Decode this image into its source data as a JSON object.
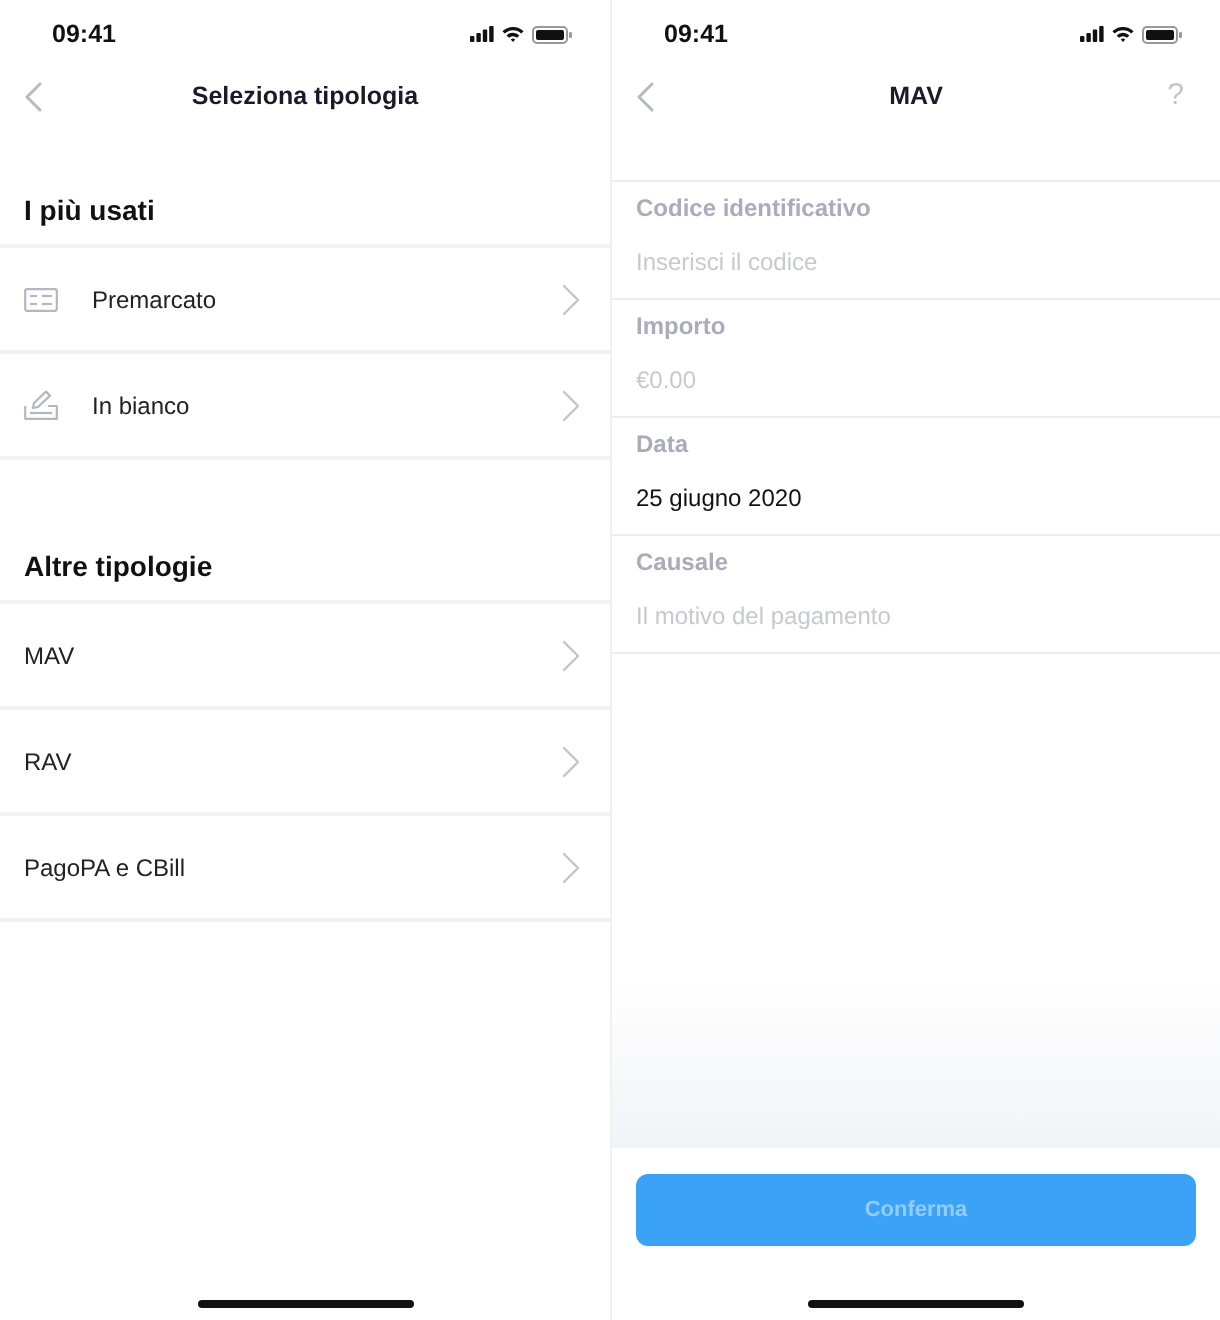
{
  "left_screen": {
    "status_bar": {
      "time": "09:41"
    },
    "nav": {
      "title": "Seleziona tipologia"
    },
    "sections": [
      {
        "title": "I più usati",
        "items": [
          {
            "label": "Premarcato",
            "kind": "card"
          },
          {
            "label": "In bianco",
            "kind": "pen"
          }
        ]
      },
      {
        "title": "Altre tipologie",
        "items": [
          {
            "label": "MAV",
            "kind": "plain"
          },
          {
            "label": "RAV",
            "kind": "plain"
          },
          {
            "label": "PagoPA e CBill",
            "kind": "plain"
          }
        ]
      }
    ]
  },
  "right_screen": {
    "status_bar": {
      "time": "09:41"
    },
    "nav": {
      "title": "MAV",
      "help": "?"
    },
    "fields": [
      {
        "label": "Codice identificativo",
        "placeholder": "Inserisci il codice"
      },
      {
        "label": "Importo",
        "placeholder": "€0.00"
      },
      {
        "label": "Data",
        "value": "25 giugno 2020"
      },
      {
        "label": "Causale",
        "placeholder": "Il motivo del pagamento"
      }
    ],
    "confirm_button": {
      "label": "Conferma",
      "disabled": true
    }
  }
}
